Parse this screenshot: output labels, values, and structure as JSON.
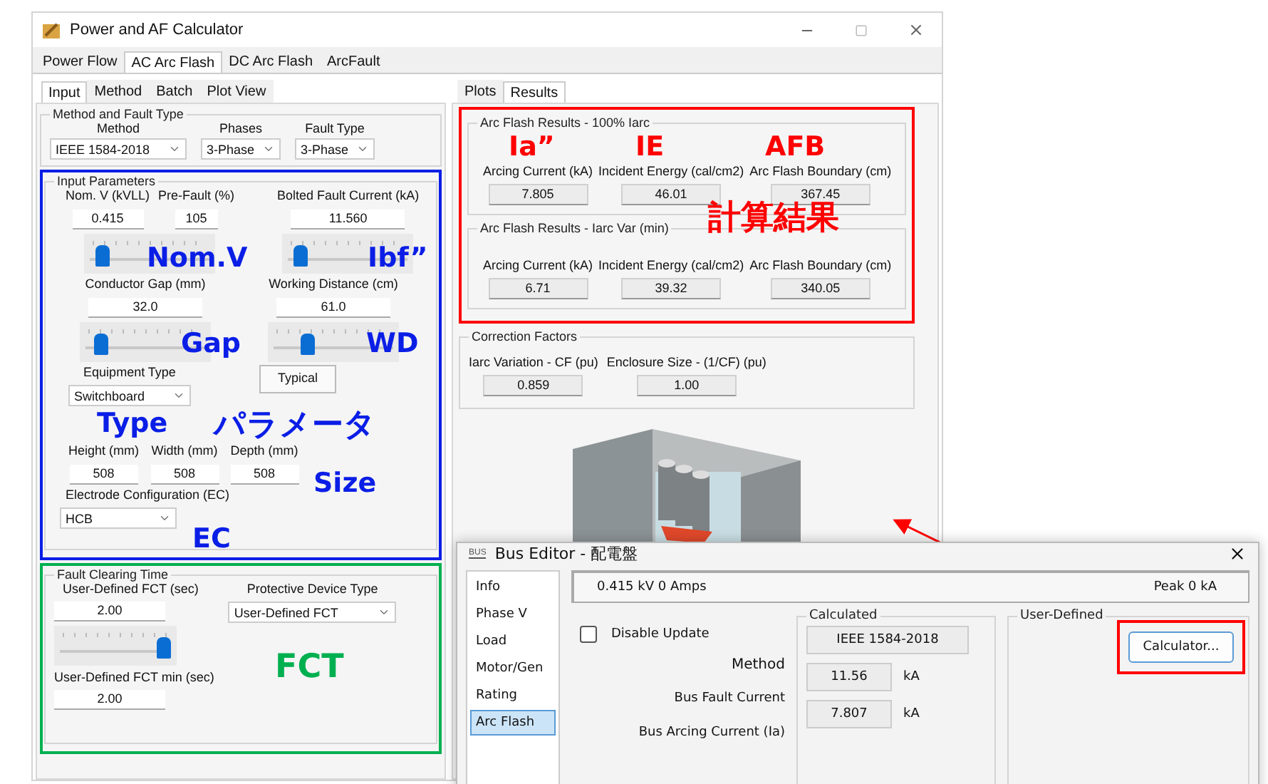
{
  "window": {
    "title": "Power and AF Calculator"
  },
  "main_tabs": [
    {
      "label": "Power Flow",
      "selected": false
    },
    {
      "label": "AC Arc Flash",
      "selected": true
    },
    {
      "label": "DC Arc Flash",
      "selected": false
    },
    {
      "label": "ArcFault",
      "selected": false
    }
  ],
  "input_tabs": [
    {
      "label": "Input",
      "selected": true
    },
    {
      "label": "Method",
      "selected": false
    },
    {
      "label": "Batch",
      "selected": false
    },
    {
      "label": "Plot View",
      "selected": false
    }
  ],
  "method_group": {
    "title": "Method and Fault Type",
    "dropdowns": [
      {
        "label": "Method",
        "value": "IEEE 1584-2018"
      },
      {
        "label": "Phases",
        "value": "3-Phase"
      },
      {
        "label": "Fault Type",
        "value": "3-Phase"
      }
    ]
  },
  "input_parameters": {
    "title": "Input Parameters",
    "slider_blocks": [
      {
        "fields": [
          {
            "label": "Nom. V (kVLL)",
            "value": "0.415"
          },
          {
            "label": "Pre-Fault (%)",
            "value": "105"
          }
        ],
        "slider": {
          "level": 0.05
        }
      },
      {
        "fields": [
          {
            "label": "Bolted Fault Current (kA)",
            "value": "11.560"
          }
        ],
        "slider": {
          "level": 0.05
        }
      },
      {
        "fields": [
          {
            "label": "Conductor Gap (mm)",
            "value": "32.0"
          }
        ],
        "slider": {
          "level": 0.08
        }
      },
      {
        "fields": [
          {
            "label": "Working Distance (cm)",
            "value": "61.0"
          }
        ],
        "slider": {
          "level": 0.25
        }
      }
    ],
    "equipment": {
      "label": "Equipment Type",
      "value": "Switchboard"
    },
    "typical_button": "Typical",
    "size_fields": [
      {
        "label": "Height (mm)",
        "value": "508"
      },
      {
        "label": "Width (mm)",
        "value": "508"
      },
      {
        "label": "Depth (mm)",
        "value": "508"
      }
    ],
    "electrode": {
      "label": "Electrode Configuration (EC)",
      "value": "HCB"
    }
  },
  "fault_clearing": {
    "title": "Fault Clearing Time",
    "fct": {
      "label": "User-Defined FCT (sec)",
      "value": "2.00"
    },
    "slider": {
      "level": 1
    },
    "fct_min": {
      "label": "User-Defined FCT min (sec)",
      "value": "2.00"
    },
    "device": {
      "label": "Protective Device Type",
      "value": "User-Defined FCT"
    }
  },
  "result_tabs": [
    {
      "label": "Plots",
      "selected": false
    },
    {
      "label": "Results",
      "selected": true
    }
  ],
  "result_groups": [
    {
      "title": "Arc Flash Results - 100% Iarc",
      "outputs": [
        {
          "label": "Arcing Current (kA)",
          "value": "7.805"
        },
        {
          "label": "Incident Energy (cal/cm2)",
          "value": "46.01"
        },
        {
          "label": "Arc Flash Boundary (cm)",
          "value": "367.45"
        }
      ]
    },
    {
      "title": "Arc Flash Results - Iarc Var (min)",
      "outputs": [
        {
          "label": "Arcing Current (kA)",
          "value": "6.71"
        },
        {
          "label": "Incident Energy (cal/cm2)",
          "value": "39.32"
        },
        {
          "label": "Arc Flash Boundary (cm)",
          "value": "340.05"
        }
      ]
    }
  ],
  "correction_factors": {
    "title": "Correction Factors",
    "outputs": [
      {
        "label": "Iarc Variation - CF (pu)",
        "value": "0.859"
      },
      {
        "label": "Enclosure Size - (1/CF) (pu)",
        "value": "1.00"
      }
    ]
  },
  "bus_editor": {
    "icon_label": "BUS",
    "title": "Bus Editor - 配電盤",
    "nav": [
      {
        "label": "Info",
        "selected": false
      },
      {
        "label": "Phase V",
        "selected": false
      },
      {
        "label": "Load",
        "selected": false
      },
      {
        "label": "Motor/Gen",
        "selected": false
      },
      {
        "label": "Rating",
        "selected": false
      },
      {
        "label": "Arc Flash",
        "selected": true
      }
    ],
    "status_left": "0.415 kV 0 Amps",
    "status_right": "Peak 0 kA",
    "disable_update": {
      "label": "Disable Update",
      "checked": false
    },
    "calculated": {
      "title": "Calculated",
      "rows": [
        {
          "label": "Method",
          "value": "IEEE 1584-2018"
        },
        {
          "label": "Bus Fault Current",
          "value": "11.56",
          "unit": "kA"
        },
        {
          "label": "Bus Arcing Current (Ia)",
          "value": "7.807",
          "unit": "kA"
        }
      ]
    },
    "user_defined": {
      "title": "User-Defined",
      "button": "Calculator..."
    }
  },
  "annotations": [
    {
      "text": "Nom.V",
      "color": "#0a1ee6"
    },
    {
      "text": "Ibf”",
      "color": "#0a1ee6"
    },
    {
      "text": "Gap",
      "color": "#0a1ee6"
    },
    {
      "text": "WD",
      "color": "#0a1ee6"
    },
    {
      "text": "Type",
      "color": "#0a1ee6"
    },
    {
      "text": "パラメータ",
      "color": "#0a1ee6"
    },
    {
      "text": "Size",
      "color": "#0a1ee6"
    },
    {
      "text": "EC",
      "color": "#0a1ee6"
    },
    {
      "text": "FCT",
      "color": "#00b050"
    },
    {
      "text": "Ia”",
      "color": "#ff0000"
    },
    {
      "text": "IE",
      "color": "#ff0000"
    },
    {
      "text": "AFB",
      "color": "#ff0000"
    },
    {
      "text": "計算結果",
      "color": "#ff0000"
    }
  ]
}
